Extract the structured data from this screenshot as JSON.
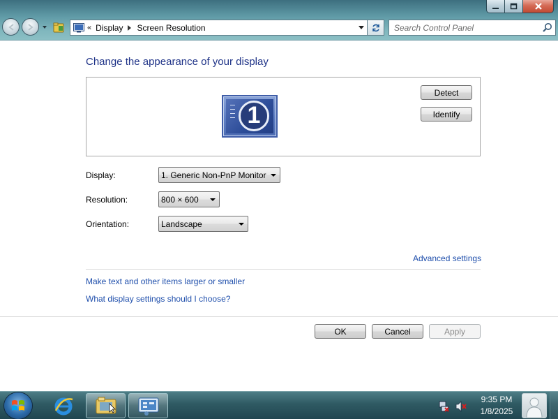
{
  "window": {
    "minimize_glyph": "minimize-icon",
    "maximize_glyph": "maximize-icon",
    "close_glyph": "close-icon"
  },
  "address_bar": {
    "overflow_chevron": "«",
    "breadcrumbs": [
      "Display",
      "Screen Resolution"
    ]
  },
  "search": {
    "placeholder": "Search Control Panel"
  },
  "main": {
    "title": "Change the appearance of your display",
    "monitor_number": "1",
    "detect_label": "Detect",
    "identify_label": "Identify",
    "display_label": "Display:",
    "display_value": "1. Generic Non-PnP Monitor",
    "resolution_label": "Resolution:",
    "resolution_value": "800 × 600",
    "orientation_label": "Orientation:",
    "orientation_value": "Landscape",
    "advanced_link": "Advanced settings",
    "text_size_link": "Make text and other items larger or smaller",
    "help_link": "What display settings should I choose?"
  },
  "footer": {
    "ok_label": "OK",
    "cancel_label": "Cancel",
    "apply_label": "Apply"
  },
  "taskbar": {
    "pinned": [
      "start-orb-icon",
      "internet-explorer-icon",
      "windows-explorer-icon",
      "control-panel-icon"
    ],
    "active_item": "windows-explorer-icon",
    "tray_icons": [
      "network-icon",
      "volume-muted-icon"
    ],
    "time": "9:35 PM",
    "date": "1/8/2025"
  },
  "colors": {
    "title_blue": "#1e3287",
    "link_blue": "#1e4eab",
    "chrome_teal": "#5f9aa6",
    "close_red": "#c24a33"
  }
}
